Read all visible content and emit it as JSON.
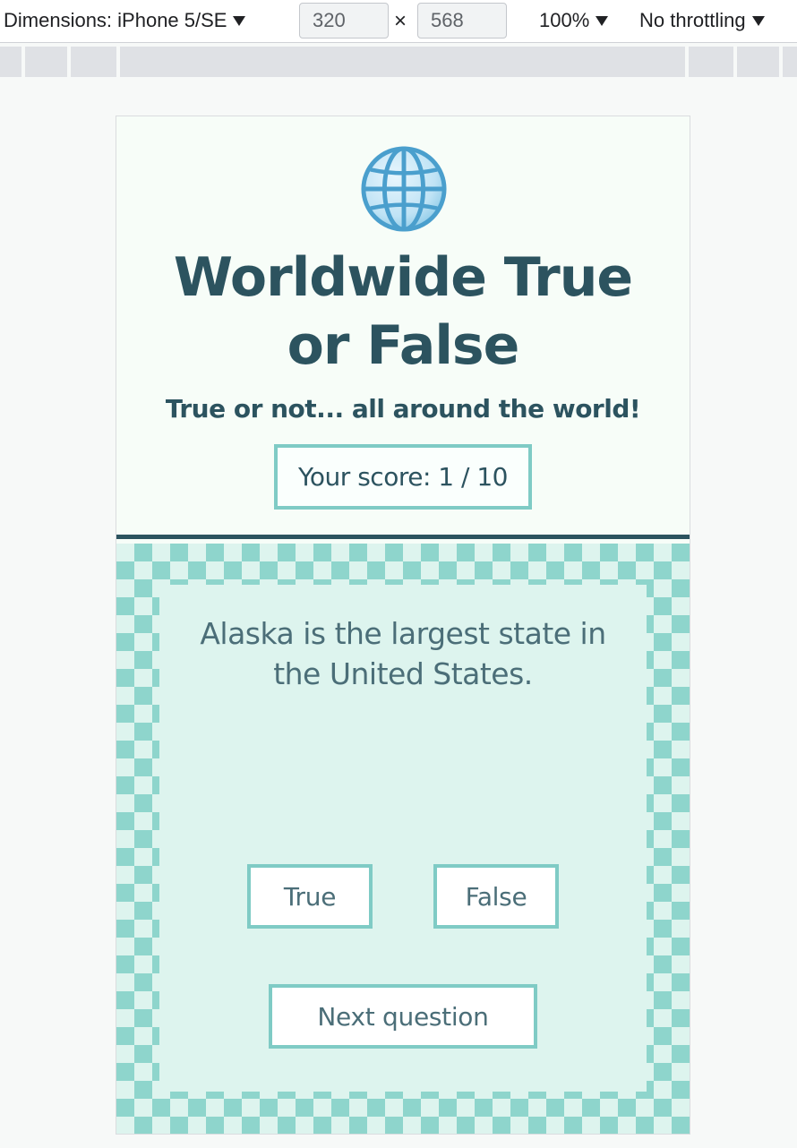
{
  "devtools": {
    "dimensions_label": "Dimensions: iPhone 5/SE",
    "width_value": "320",
    "height_value": "568",
    "times_symbol": "×",
    "zoom_label": "100%",
    "throttling_label": "No throttling"
  },
  "app": {
    "icon": "globe-icon",
    "title": "Worldwide True or False",
    "subtitle": "True or not... all around the world!",
    "score_label": "Your score: 1 / 10"
  },
  "quiz": {
    "question": "Alaska is the largest state in the United States.",
    "true_label": "True",
    "false_label": "False",
    "next_label": "Next question"
  },
  "colors": {
    "primary_text": "#2c535f",
    "accent_border": "#7fcbc5",
    "checker_dark": "#8ed5cc",
    "checker_light": "#ddf4ee"
  }
}
